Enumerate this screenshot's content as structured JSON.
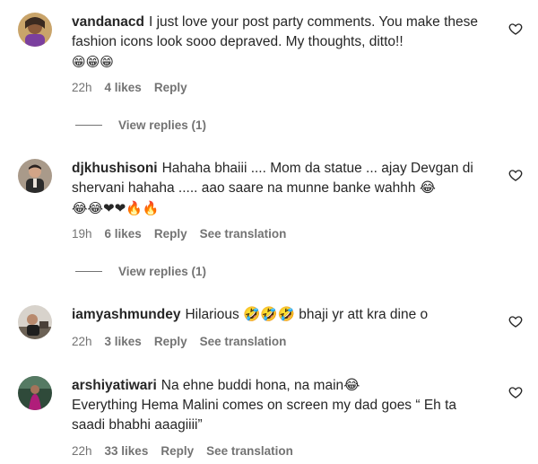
{
  "comments": [
    {
      "username": "vandanacd",
      "text": "I just love your post party comments. You make these fashion icons look sooo depraved. My thoughts, ditto!!",
      "emoji": "😁😁😁",
      "time": "22h",
      "likes": "4 likes",
      "reply": "Reply",
      "view_replies": "View replies (1)"
    },
    {
      "username": "djkhushisoni",
      "text": "Hahaha bhaiii .... Mom da statue ... ajay Devgan di shervani hahaha ..... aao saare na munne banke wahhh 😂",
      "emoji": "😂😂❤❤🔥🔥",
      "time": "19h",
      "likes": "6 likes",
      "reply": "Reply",
      "translation": "See translation",
      "view_replies": "View replies (1)"
    },
    {
      "username": "iamyashmundey",
      "text": "Hilarious 🤣🤣🤣 bhaji yr att kra dine o",
      "time": "22h",
      "likes": "3 likes",
      "reply": "Reply",
      "translation": "See translation"
    },
    {
      "username": "arshiyatiwari",
      "text": "Na ehne buddi hona, na main😂",
      "text2": "Everything Hema Malini comes on screen my dad goes “ Eh ta saadi bhabhi aaagiiii”",
      "time": "22h",
      "likes": "33 likes",
      "reply": "Reply",
      "translation": "See translation"
    }
  ],
  "icons": {
    "like": "heart-outline-icon"
  }
}
